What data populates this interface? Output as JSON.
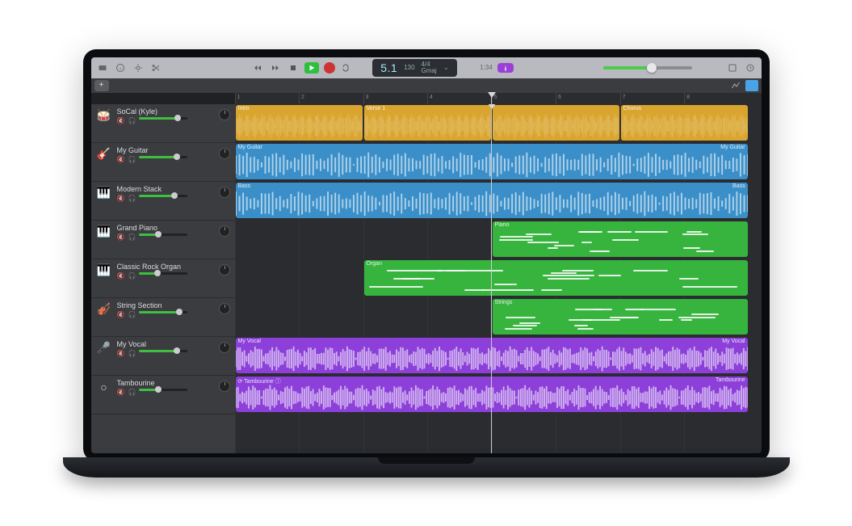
{
  "app": "GarageBand",
  "toolbar": {
    "transport": {
      "position_beats": "5.1",
      "bpm": "130",
      "signature": "4/4",
      "key": "Gmaj"
    },
    "tuner_time": "1:34",
    "master_volume_pct": 55
  },
  "ruler": {
    "bars": [
      1,
      2,
      3,
      4,
      5,
      6,
      7,
      8
    ]
  },
  "playhead_bar": 5,
  "tracks": [
    {
      "name": "SoCal (Kyle)",
      "icon": "🥁",
      "volume_pct": 80,
      "color": "yellow",
      "type": "audio",
      "regions": [
        {
          "label": "Intro",
          "start": 1,
          "end": 3
        },
        {
          "label": "Verse 1",
          "start": 3,
          "end": 5
        },
        {
          "label": "",
          "start": 5,
          "end": 7
        },
        {
          "label": "Chorus",
          "start": 7,
          "end": 9
        }
      ]
    },
    {
      "name": "My Guitar",
      "icon": "🎸",
      "volume_pct": 78,
      "color": "blue",
      "type": "audio",
      "regions": [
        {
          "label": "My Guitar",
          "start": 1,
          "end": 9,
          "rlabel": "My Guitar"
        }
      ]
    },
    {
      "name": "Modern Stack",
      "icon": "🎹",
      "volume_pct": 72,
      "color": "blue",
      "type": "audio",
      "regions": [
        {
          "label": "Bass",
          "start": 1,
          "end": 9,
          "rlabel": "Bass"
        }
      ]
    },
    {
      "name": "Grand Piano",
      "icon": "🎹",
      "volume_pct": 40,
      "color": "green",
      "type": "midi",
      "regions": [
        {
          "label": "Piano",
          "start": 5,
          "end": 9
        }
      ]
    },
    {
      "name": "Classic Rock Organ",
      "icon": "🎹",
      "volume_pct": 38,
      "color": "green",
      "type": "midi",
      "regions": [
        {
          "label": "Organ",
          "start": 3,
          "end": 9
        }
      ]
    },
    {
      "name": "String Section",
      "icon": "🎻",
      "volume_pct": 82,
      "color": "green",
      "type": "midi",
      "regions": [
        {
          "label": "Strings",
          "start": 5,
          "end": 9
        }
      ]
    },
    {
      "name": "My Vocal",
      "icon": "🎤",
      "volume_pct": 78,
      "color": "purple",
      "type": "audio",
      "regions": [
        {
          "label": "My Vocal",
          "start": 1,
          "end": 9,
          "rlabel": "My Vocal"
        }
      ]
    },
    {
      "name": "Tambourine",
      "icon": "○",
      "volume_pct": 40,
      "color": "purple",
      "type": "audio",
      "regions": [
        {
          "label": "⟳ Tambourine  ⓘ",
          "start": 1,
          "end": 9,
          "rlabel": "Tambourine"
        }
      ]
    }
  ]
}
